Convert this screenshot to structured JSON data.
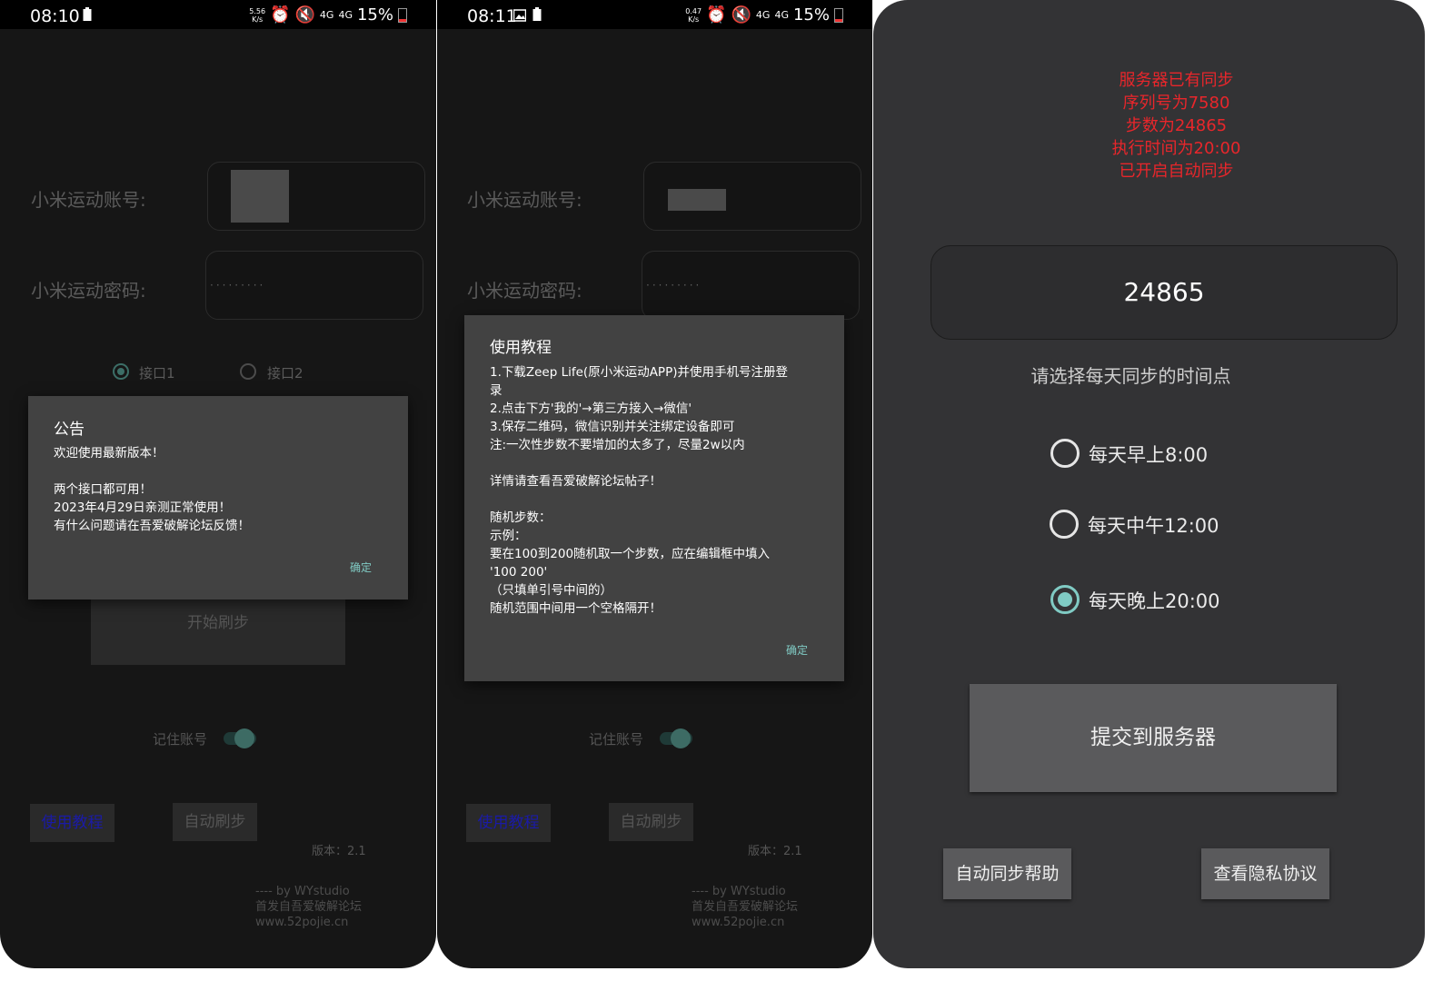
{
  "phone1": {
    "status": {
      "time": "08:10",
      "speed_top": "5.56",
      "speed_unit": "K/s",
      "net1": "4G",
      "net2": "4G",
      "battery": "15%"
    },
    "account_label": "小米运动账号:",
    "password_label": "小米运动密码:",
    "password_value": "·········",
    "api1_label": "接口1",
    "api2_label": "接口2",
    "start_button": "开始刷步",
    "remember_label": "记住账号",
    "tutorial_button": "使用教程",
    "auto_button": "自动刷步",
    "version": "版本：2.1",
    "footer": [
      "---- by WYstudio",
      "首发自吾爱破解论坛",
      "www.52pojie.cn"
    ],
    "dialog": {
      "title": "公告",
      "body": "欢迎使用最新版本！\n\n两个接口都可用！\n2023年4月29日亲测正常使用！\n有什么问题请在吾爱破解论坛反馈！",
      "ok": "确定"
    }
  },
  "phone2": {
    "status": {
      "time": "08:11",
      "speed_top": "0.47",
      "speed_unit": "K/s",
      "net1": "4G",
      "net2": "4G",
      "battery": "15%"
    },
    "account_label": "小米运动账号:",
    "password_label": "小米运动密码:",
    "password_value": "·········",
    "remember_label": "记住账号",
    "tutorial_button": "使用教程",
    "auto_button": "自动刷步",
    "version": "版本：2.1",
    "footer": [
      "---- by WYstudio",
      "首发自吾爱破解论坛",
      "www.52pojie.cn"
    ],
    "dialog": {
      "title": "使用教程",
      "body": "1.下载Zeep Life(原小米运动APP)并使用手机号注册登\n录\n2.点击下方'我的'→第三方接入→微信'\n3.保存二维码，微信识别并关注绑定设备即可\n注:一次性步数不要增加的太多了，尽量2w以内\n\n详情请查看吾爱破解论坛帖子！\n\n随机步数：\n示例：\n要在100到200随机取一个步数，应在编辑框中填入\n'100 200'\n（只填单引号中间的）\n随机范围中间用一个空格隔开！",
      "ok": "确定"
    }
  },
  "phone3": {
    "server_status": [
      "服务器已有同步",
      "序列号为7580",
      "步数为24865",
      "执行时间为20:00",
      "已开启自动同步"
    ],
    "steps_value": "24865",
    "hint": "请选择每天同步的时间点",
    "options": [
      "每天早上8:00",
      "每天中午12:00",
      "每天晚上20:00"
    ],
    "selected_option": "每天晚上20:00",
    "submit_button": "提交到服务器",
    "help_button": "自动同步帮助",
    "privacy_button": "查看隐私协议"
  },
  "colors": {
    "accent": "#80cbc4",
    "alert_red": "#e8262b",
    "link_blue": "#1a1aa8"
  }
}
